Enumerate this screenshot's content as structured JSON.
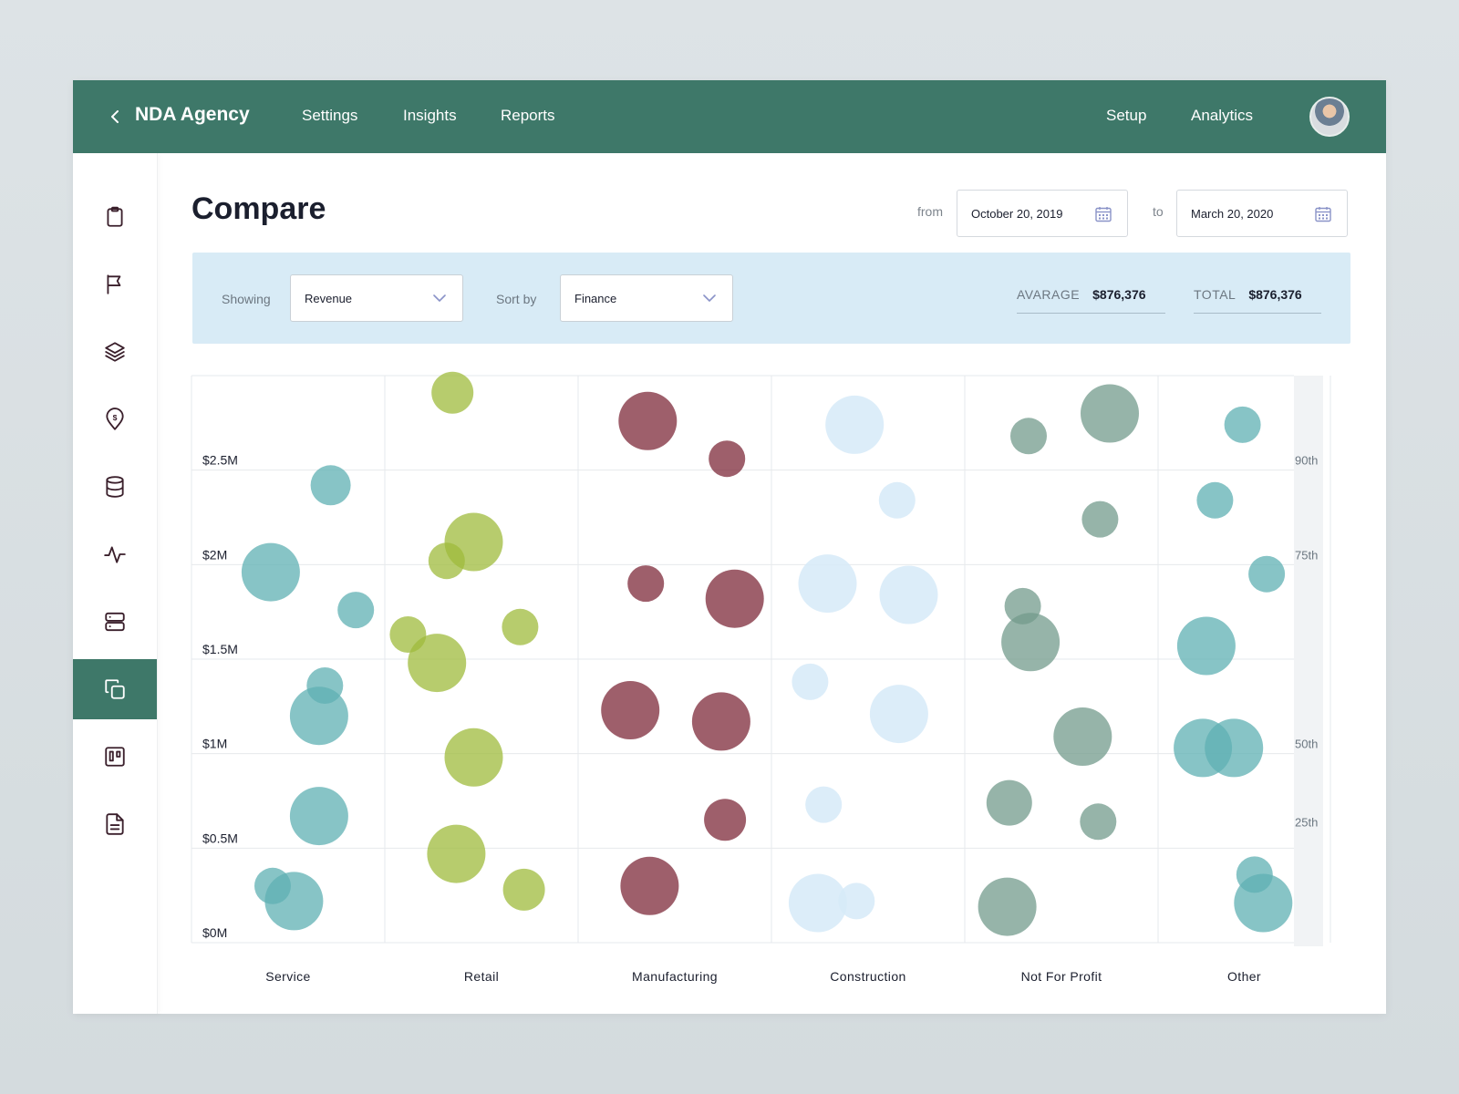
{
  "topbar": {
    "brand": "NDA Agency",
    "nav_left": [
      "Settings",
      "Insights",
      "Reports"
    ],
    "nav_right": [
      "Setup",
      "Analytics"
    ]
  },
  "sidebar": {
    "items": [
      {
        "icon": "clipboard-icon",
        "active": false
      },
      {
        "icon": "flag-icon",
        "active": false
      },
      {
        "icon": "layers-icon",
        "active": false
      },
      {
        "icon": "location-dollar-icon",
        "active": false
      },
      {
        "icon": "database-icon",
        "active": false
      },
      {
        "icon": "activity-icon",
        "active": false
      },
      {
        "icon": "server-icon",
        "active": false
      },
      {
        "icon": "compare-icon",
        "active": true
      },
      {
        "icon": "board-icon",
        "active": false
      },
      {
        "icon": "document-icon",
        "active": false
      }
    ]
  },
  "page": {
    "title": "Compare",
    "from_label": "from",
    "from_date": "October 20, 2019",
    "to_label": "to",
    "to_date": "March 20, 2020"
  },
  "filters": {
    "showing_label": "Showing",
    "showing_value": "Revenue",
    "sort_label": "Sort by",
    "sort_value": "Finance",
    "average_label": "AVARAGE",
    "average_value": "$876,376",
    "total_label": "TOTAL",
    "total_value": "$876,376"
  },
  "chart_data": {
    "type": "scatter",
    "title": "",
    "xlabel": "",
    "ylabel": "",
    "categories": [
      "Service",
      "Retail",
      "Manufacturing",
      "Construction",
      "Not For Profit",
      "Other"
    ],
    "y_ticks": [
      "$2.5M",
      "$2M",
      "$1.5M",
      "$1M",
      "$0.5M",
      "$0M"
    ],
    "percentile_labels": [
      "90th",
      "75th",
      "50th",
      "25th"
    ],
    "ylim": [
      0,
      3
    ],
    "grid": true,
    "colors": {
      "Service": "#5fb0b3",
      "Retail": "#9fbb3c",
      "Manufacturing": "#7e2a3a",
      "Construction": "#d6eaf8",
      "Not For Profit": "#739b8c",
      "Other": "#5fb0b3"
    },
    "series": [
      {
        "name": "Service",
        "points": [
          {
            "x": 0.72,
            "y": 2.42,
            "r": 22
          },
          {
            "x": 0.41,
            "y": 1.96,
            "r": 32
          },
          {
            "x": 0.85,
            "y": 1.76,
            "r": 20
          },
          {
            "x": 0.69,
            "y": 1.36,
            "r": 20
          },
          {
            "x": 0.66,
            "y": 1.2,
            "r": 32
          },
          {
            "x": 0.66,
            "y": 0.67,
            "r": 32
          },
          {
            "x": 0.42,
            "y": 0.3,
            "r": 20
          },
          {
            "x": 0.53,
            "y": 0.22,
            "r": 32
          }
        ]
      },
      {
        "name": "Retail",
        "points": [
          {
            "x": 0.35,
            "y": 2.91,
            "r": 23
          },
          {
            "x": 0.46,
            "y": 2.12,
            "r": 32
          },
          {
            "x": 0.32,
            "y": 2.02,
            "r": 20
          },
          {
            "x": 0.7,
            "y": 1.67,
            "r": 20
          },
          {
            "x": 0.12,
            "y": 1.63,
            "r": 20
          },
          {
            "x": 0.27,
            "y": 1.48,
            "r": 32
          },
          {
            "x": 0.46,
            "y": 0.98,
            "r": 32
          },
          {
            "x": 0.37,
            "y": 0.47,
            "r": 32
          },
          {
            "x": 0.72,
            "y": 0.28,
            "r": 23
          }
        ]
      },
      {
        "name": "Manufacturing",
        "points": [
          {
            "x": 0.36,
            "y": 2.76,
            "r": 32
          },
          {
            "x": 0.77,
            "y": 2.56,
            "r": 20
          },
          {
            "x": 0.35,
            "y": 1.9,
            "r": 20
          },
          {
            "x": 0.81,
            "y": 1.82,
            "r": 32
          },
          {
            "x": 0.27,
            "y": 1.23,
            "r": 32
          },
          {
            "x": 0.74,
            "y": 1.17,
            "r": 32
          },
          {
            "x": 0.76,
            "y": 0.65,
            "r": 23
          },
          {
            "x": 0.37,
            "y": 0.3,
            "r": 32
          }
        ]
      },
      {
        "name": "Construction",
        "points": [
          {
            "x": 0.43,
            "y": 2.74,
            "r": 32
          },
          {
            "x": 0.65,
            "y": 2.34,
            "r": 20
          },
          {
            "x": 0.29,
            "y": 1.9,
            "r": 32
          },
          {
            "x": 0.71,
            "y": 1.84,
            "r": 32
          },
          {
            "x": 0.2,
            "y": 1.38,
            "r": 20
          },
          {
            "x": 0.66,
            "y": 1.21,
            "r": 32
          },
          {
            "x": 0.27,
            "y": 0.73,
            "r": 20
          },
          {
            "x": 0.24,
            "y": 0.21,
            "r": 32
          },
          {
            "x": 0.44,
            "y": 0.22,
            "r": 20
          }
        ]
      },
      {
        "name": "Not For Profit",
        "points": [
          {
            "x": 0.33,
            "y": 2.68,
            "r": 20
          },
          {
            "x": 0.75,
            "y": 2.8,
            "r": 32
          },
          {
            "x": 0.7,
            "y": 2.24,
            "r": 20
          },
          {
            "x": 0.3,
            "y": 1.78,
            "r": 20
          },
          {
            "x": 0.34,
            "y": 1.59,
            "r": 32
          },
          {
            "x": 0.61,
            "y": 1.09,
            "r": 32
          },
          {
            "x": 0.23,
            "y": 0.74,
            "r": 25
          },
          {
            "x": 0.69,
            "y": 0.64,
            "r": 20
          },
          {
            "x": 0.22,
            "y": 0.19,
            "r": 32
          }
        ]
      },
      {
        "name": "Other",
        "points": [
          {
            "x": 0.49,
            "y": 2.74,
            "r": 20
          },
          {
            "x": 0.33,
            "y": 2.34,
            "r": 20
          },
          {
            "x": 0.63,
            "y": 1.95,
            "r": 20
          },
          {
            "x": 0.28,
            "y": 1.57,
            "r": 32
          },
          {
            "x": 0.26,
            "y": 1.03,
            "r": 32
          },
          {
            "x": 0.44,
            "y": 1.03,
            "r": 32
          },
          {
            "x": 0.56,
            "y": 0.36,
            "r": 20
          },
          {
            "x": 0.61,
            "y": 0.21,
            "r": 32
          }
        ]
      }
    ]
  }
}
